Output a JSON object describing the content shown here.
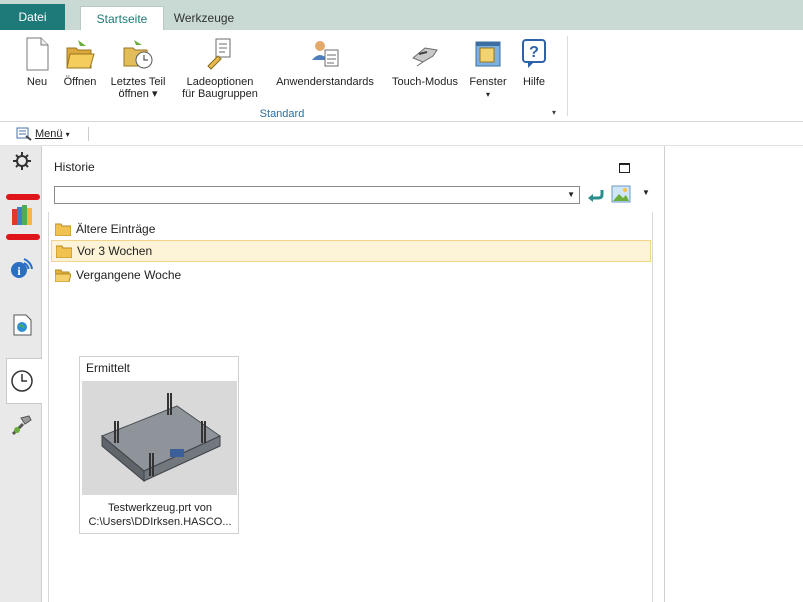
{
  "tabs": [
    {
      "label": "Datei"
    },
    {
      "label": "Startseite"
    },
    {
      "label": "Werkzeuge"
    }
  ],
  "ribbon": {
    "buttons": [
      {
        "label": "Neu",
        "icon": "new-file-icon"
      },
      {
        "label": "Öffnen",
        "icon": "open-folder-icon"
      },
      {
        "label": "Letztes Teil",
        "label2": "öffnen ▾",
        "icon": "recent-part-icon"
      },
      {
        "label": "Ladeoptionen",
        "label2": "für Baugruppen",
        "icon": "load-options-icon"
      },
      {
        "label": "Anwenderstandards",
        "icon": "user-defaults-icon"
      },
      {
        "label": "Touch-Modus",
        "icon": "touch-mode-icon"
      },
      {
        "label": "Fenster",
        "label2": "▾",
        "icon": "window-icon"
      },
      {
        "label": "Hilfe",
        "icon": "help-icon"
      }
    ],
    "group_label": "Standard"
  },
  "menubar": {
    "menu_label": "Menü",
    "menu_caret": "▾"
  },
  "panel": {
    "title": "Historie",
    "search_value": "",
    "rows": [
      {
        "label": "Ältere Einträge"
      },
      {
        "label": "Vor 3 Wochen"
      },
      {
        "label": "Vergangene Woche"
      }
    ],
    "card": {
      "header": "Ermittelt",
      "caption_line1": "Testwerkzeug.prt von",
      "caption_line2": "C:\\Users\\DDIrksen.HASCO..."
    }
  },
  "colors": {
    "accent": "#1e7a78",
    "selection": "#fdf3d6",
    "annotation": "#e0151c"
  }
}
